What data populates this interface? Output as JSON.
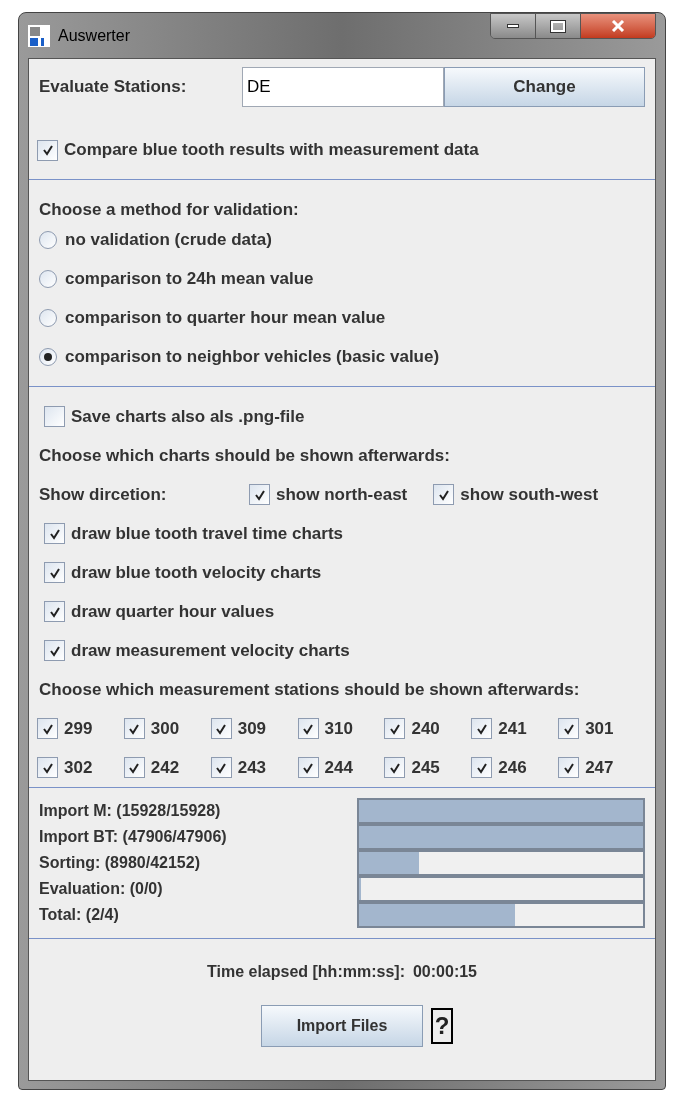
{
  "window": {
    "title": "Auswerter"
  },
  "stations_field": {
    "label": "Evaluate Stations:",
    "value": "DE",
    "button": "Change"
  },
  "compare": {
    "label": "Compare blue tooth results with measurement data",
    "checked": true
  },
  "validation": {
    "heading": "Choose a method for validation:",
    "options": [
      {
        "label": "no validation (crude data)",
        "selected": false
      },
      {
        "label": "comparison to 24h mean value",
        "selected": false
      },
      {
        "label": "comparison to quarter hour mean value",
        "selected": false
      },
      {
        "label": "comparison to neighbor vehicles (basic value)",
        "selected": true
      }
    ]
  },
  "save_png": {
    "label": "Save charts also als .png-file",
    "checked": false
  },
  "charts_heading": "Choose which charts should be shown afterwards:",
  "direction": {
    "label": "Show dircetion:",
    "options": [
      {
        "label": "show north-east",
        "checked": true
      },
      {
        "label": "show south-west",
        "checked": true
      }
    ]
  },
  "chart_options": [
    {
      "label": "draw blue tooth travel time charts",
      "checked": true
    },
    {
      "label": "draw blue tooth velocity charts",
      "checked": true
    },
    {
      "label": "draw quarter hour values",
      "checked": true
    },
    {
      "label": "draw measurement velocity charts",
      "checked": true
    }
  ],
  "stations_heading": "Choose which measurement stations should be shown afterwards:",
  "stations": [
    {
      "label": "299",
      "checked": true
    },
    {
      "label": "300",
      "checked": true
    },
    {
      "label": "309",
      "checked": true
    },
    {
      "label": "310",
      "checked": true
    },
    {
      "label": "240",
      "checked": true
    },
    {
      "label": "241",
      "checked": true
    },
    {
      "label": "301",
      "checked": true
    },
    {
      "label": "302",
      "checked": true
    },
    {
      "label": "242",
      "checked": true
    },
    {
      "label": "243",
      "checked": true
    },
    {
      "label": "244",
      "checked": true
    },
    {
      "label": "245",
      "checked": true
    },
    {
      "label": "246",
      "checked": true
    },
    {
      "label": "247",
      "checked": true
    }
  ],
  "progress": [
    {
      "label": "Import M: (15928/15928)",
      "level": 1
    },
    {
      "label": "Import BT: (47906/47906)",
      "level": 1
    },
    {
      "label": "Sorting: (8980/42152)",
      "level": 0.21
    },
    {
      "label": "Evaluation: (0/0)",
      "level": 0
    },
    {
      "label": "Total: (2/4)",
      "level": 0.55
    }
  ],
  "time": {
    "label": "Time elapsed [hh:mm:ss]:",
    "value": "00:00:15"
  },
  "import_button": "Import Files",
  "help_button": "?"
}
